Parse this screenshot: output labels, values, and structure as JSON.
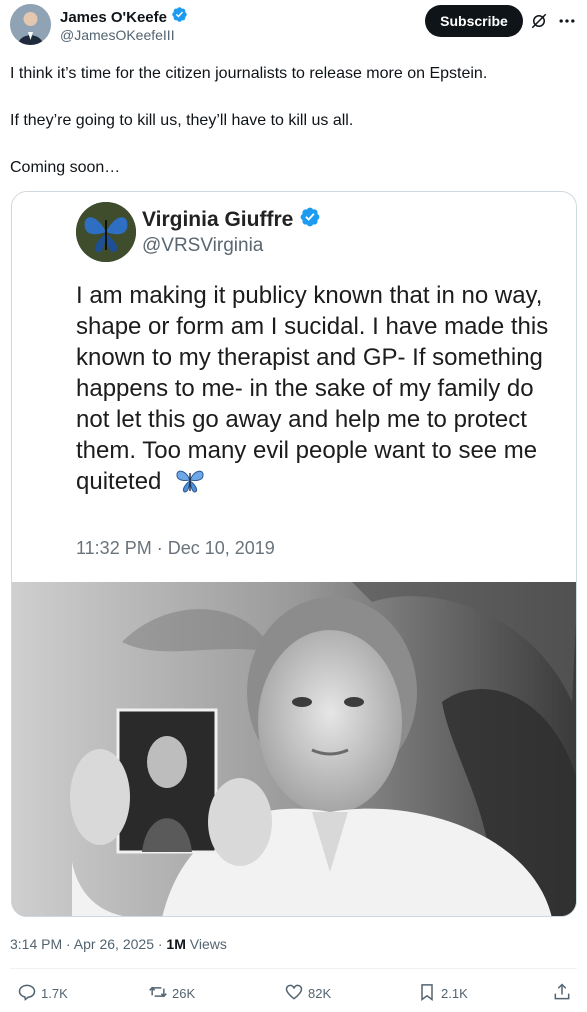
{
  "author": {
    "display_name": "James O'Keefe",
    "handle": "@JamesOKeefeIII",
    "verified": true
  },
  "header": {
    "subscribe_label": "Subscribe",
    "grok_icon": "grok-icon",
    "more_icon": "more-icon"
  },
  "tweet": {
    "lines": [
      "I think it’s time for the citizen journalists to release more on Epstein.",
      "If they’re going to kill us, they’ll have to kill us all.",
      "Coming soon…"
    ],
    "time": "3:14 PM · Apr 26, 2025 · ",
    "views_count": "1M",
    "views_label": " Views"
  },
  "quoted_screenshot": {
    "display_name": "Virginia Giuffre",
    "handle": "@VRSVirginia",
    "verified": true,
    "body": "I am making it publicy known that in no way, shape or form am I sucidal. I have made this known to my therapist and GP- If something happens to me- in the sake of my family do not let this go away and help me to protect them. Too many evil people want to see me quiteted",
    "time": "11:32 PM · Dec 10, 2019",
    "emoji_icon": "butterfly-icon"
  },
  "actions": {
    "replies": "1.7K",
    "reposts": "26K",
    "likes": "82K",
    "bookmarks": "2.1K"
  },
  "colors": {
    "verified": "#1d9bf0",
    "secondary_text": "#536471",
    "primary_text": "#0f1419"
  }
}
